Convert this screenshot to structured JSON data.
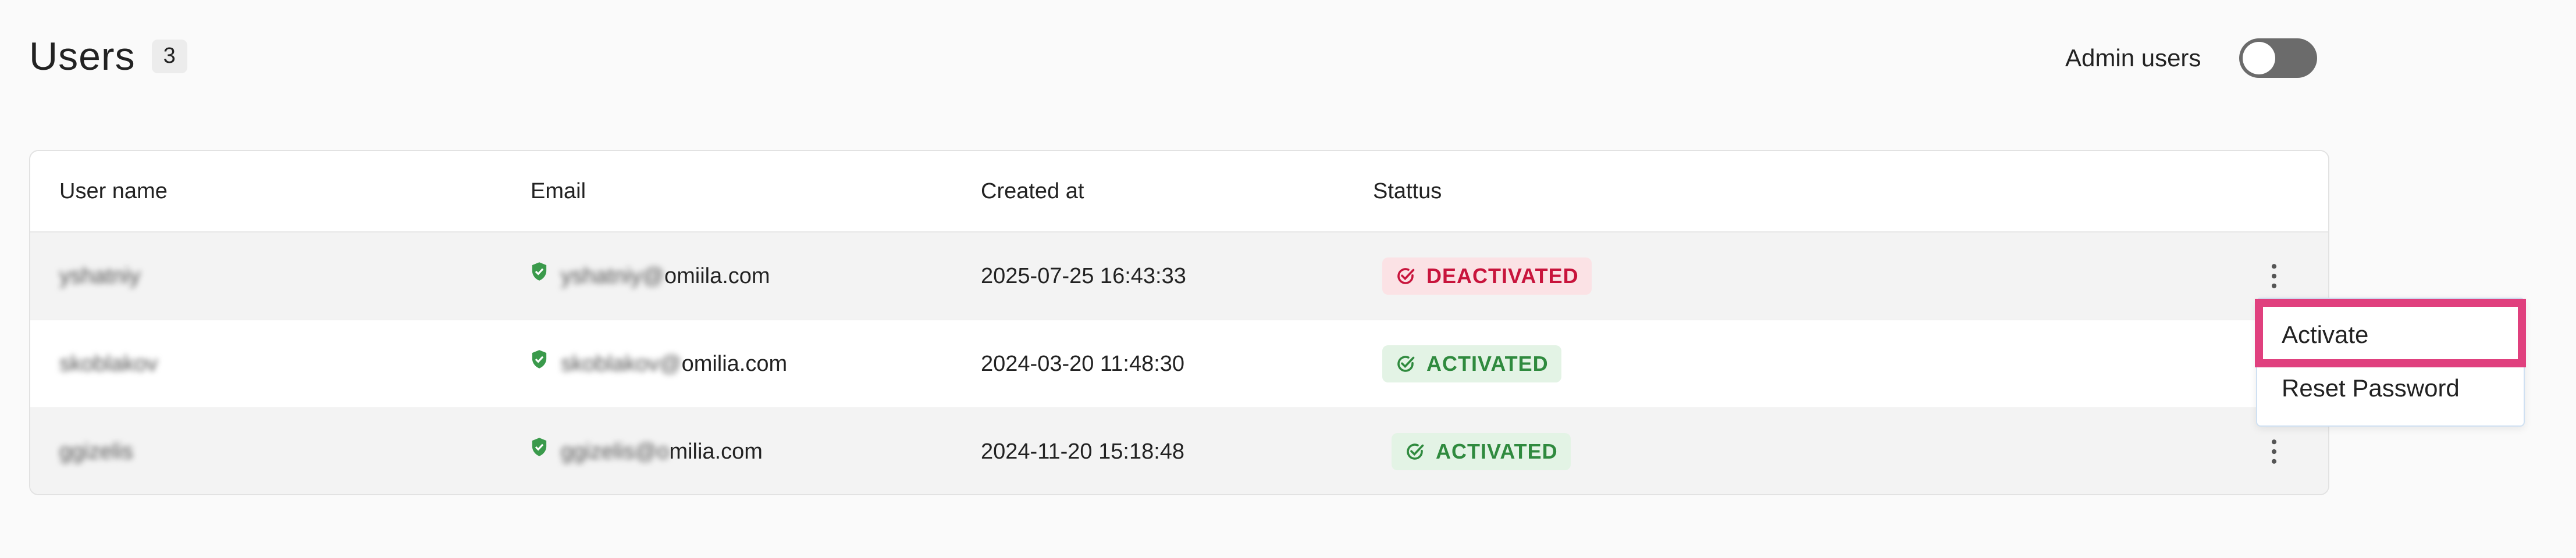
{
  "header": {
    "title": "Users",
    "count": "3",
    "admin_label": "Admin users",
    "admin_toggle_on": false
  },
  "table": {
    "columns": [
      "User name",
      "Email",
      "Created at",
      "Stattus"
    ],
    "rows": [
      {
        "username": "yshatniy",
        "email_user": "yshatniy@",
        "email_domain": "omiila.com",
        "created": "2025-07-25 16:43:33",
        "status": "DEACTIVATED"
      },
      {
        "username": "skoblakov",
        "email_user": "skoblakov@",
        "email_domain": "omilia.com",
        "created": "2024-03-20 11:48:30",
        "status": "ACTIVATED"
      },
      {
        "username": "ggizelis",
        "email_user": "ggizelis@o",
        "email_domain": "milia.com",
        "created": "2024-11-20 15:18:48",
        "status": "ACTIVATED"
      }
    ]
  },
  "menu": {
    "items": [
      "Activate",
      "Reset Password"
    ],
    "highlight_color": "#e0407e"
  },
  "colors": {
    "deactivated": "#c8143c",
    "activated": "#2f8a3e",
    "verified_shield": "#3a9a4b"
  },
  "icons": [
    "verified-shield-icon",
    "check-circle-icon",
    "kebab-menu-icon"
  ]
}
